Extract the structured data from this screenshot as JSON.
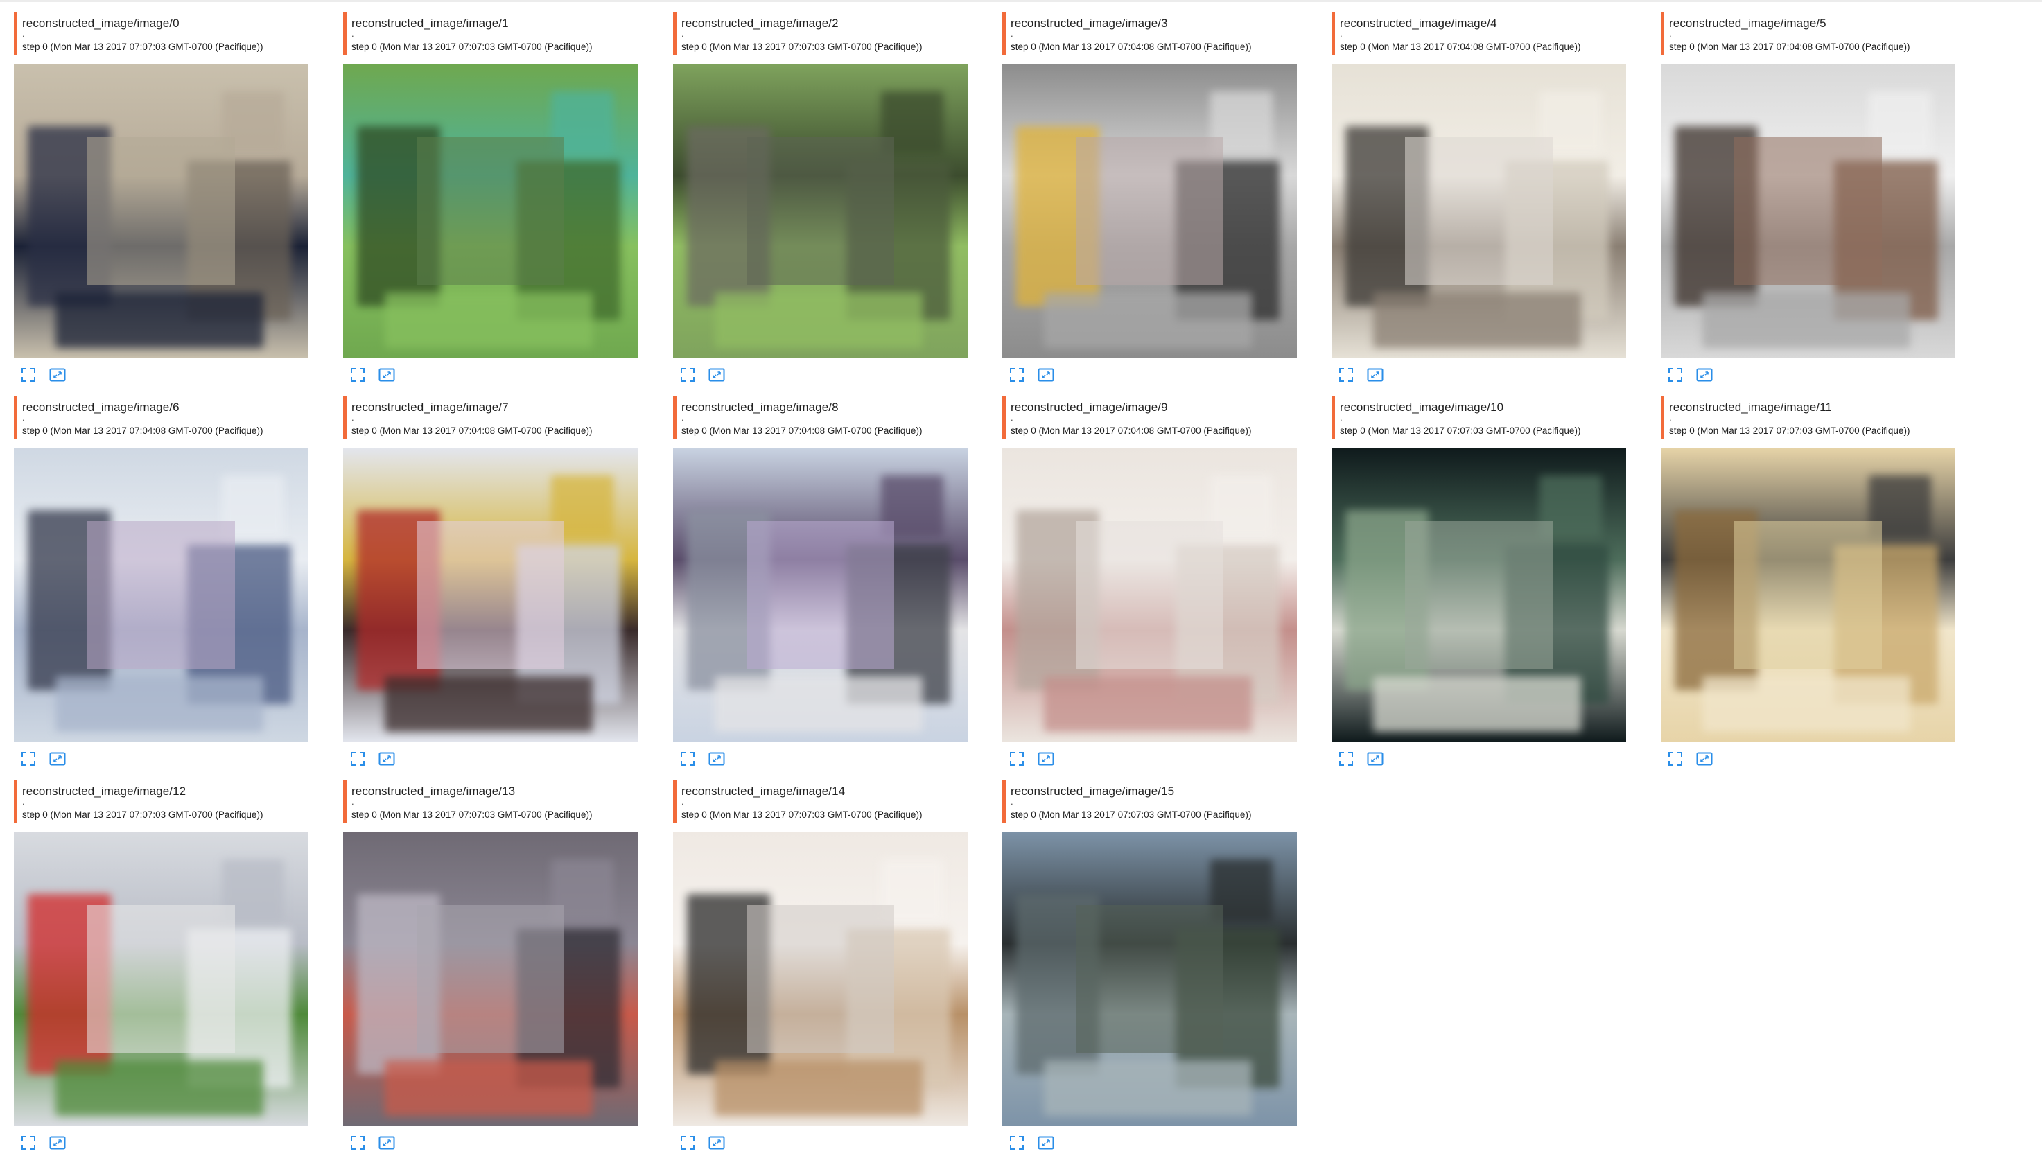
{
  "accent_color": "#f26b3a",
  "icon_color": "#2a8ee8",
  "step_text": "step 0",
  "cards": [
    {
      "title": "reconstructed_image/image/0",
      "dot": ".",
      "step": "step 0 (Mon Mar 13 2017 07:07:03 GMT-0700 (Pacifique))",
      "palette": [
        "#c9c0ad",
        "#6b6257",
        "#2a2f45",
        "#1b2236",
        "#b7ab99"
      ],
      "mask": "#b2a996"
    },
    {
      "title": "reconstructed_image/image/1",
      "dot": ".",
      "step": "step 0 (Mon Mar 13 2017 07:07:03 GMT-0700 (Pacifique))",
      "palette": [
        "#6fa84f",
        "#3f6a2c",
        "#2e4a22",
        "#87c05e",
        "#4fb39a"
      ],
      "mask": "#5b7d4a"
    },
    {
      "title": "reconstructed_image/image/2",
      "dot": ".",
      "step": "step 0 (Mon Mar 13 2017 07:07:03 GMT-0700 (Pacifique))",
      "palette": [
        "#7fa35d",
        "#4b5a3c",
        "#6b6a60",
        "#91bd62",
        "#3c4c2e"
      ],
      "mask": "#5d6453"
    },
    {
      "title": "reconstructed_image/image/3",
      "dot": ".",
      "step": "step 0 (Mon Mar 13 2017 07:04:08 GMT-0700 (Pacifique))",
      "palette": [
        "#8c8c8c",
        "#2d2d2d",
        "#e0b33a",
        "#a7a7a7",
        "#d8d8d8"
      ],
      "mask": "#b8a7a8"
    },
    {
      "title": "reconstructed_image/image/4",
      "dot": ".",
      "step": "step 0 (Mon Mar 13 2017 07:04:08 GMT-0700 (Pacifique))",
      "palette": [
        "#e6e1d6",
        "#d2cbbd",
        "#3d3a36",
        "#8a7f73",
        "#f2eee6"
      ],
      "mask": "#dcd7d2"
    },
    {
      "title": "reconstructed_image/image/5",
      "dot": ".",
      "step": "step 0 (Mon Mar 13 2017 07:04:08 GMT-0700 (Pacifique))",
      "palette": [
        "#d9d9d9",
        "#7d5a46",
        "#3b302a",
        "#a8a8a8",
        "#efefef"
      ],
      "mask": "#8f6d5c"
    },
    {
      "title": "reconstructed_image/image/6",
      "dot": ".",
      "step": "step 0 (Mon Mar 13 2017 07:04:08 GMT-0700 (Pacifique))",
      "palette": [
        "#cfd8e3",
        "#4a5a82",
        "#34394c",
        "#a7b4cb",
        "#e9edf2"
      ],
      "mask": "#b9a8c6"
    },
    {
      "title": "reconstructed_image/image/7",
      "dot": ".",
      "step": "step 0 (Mon Mar 13 2017 07:04:08 GMT-0700 (Pacifique))",
      "palette": [
        "#e3e6ee",
        "#d0d4e2",
        "#b02a2a",
        "#3a2b2b",
        "#d6b640"
      ],
      "mask": "#e3cfe0"
    },
    {
      "title": "reconstructed_image/image/8",
      "dot": ".",
      "step": "step 0 (Mon Mar 13 2017 07:04:08 GMT-0700 (Pacifique))",
      "palette": [
        "#c9d3e2",
        "#3e4149",
        "#8b91a0",
        "#e4e4e6",
        "#5a4d6b"
      ],
      "mask": "#b9a9d2"
    },
    {
      "title": "reconstructed_image/image/9",
      "dot": ".",
      "step": "step 0 (Mon Mar 13 2017 07:04:08 GMT-0700 (Pacifique))",
      "palette": [
        "#ebe5df",
        "#d6ccc4",
        "#b4a79e",
        "#c48f8b",
        "#f3efeb"
      ],
      "mask": "#e6e0dc"
    },
    {
      "title": "reconstructed_image/image/10",
      "dot": ".",
      "step": "step 0 (Mon Mar 13 2017 07:07:03 GMT-0700 (Pacifique))",
      "palette": [
        "#0f1a1c",
        "#2f4a40",
        "#8aa58a",
        "#d7d9d0",
        "#4d6d5b"
      ],
      "mask": "#9aa89a"
    },
    {
      "title": "reconstructed_image/image/11",
      "dot": ".",
      "step": "step 0 (Mon Mar 13 2017 07:07:03 GMT-0700 (Pacifique))",
      "palette": [
        "#e7d4a8",
        "#c9a86b",
        "#8b6a3c",
        "#f1e6cb",
        "#3d3d3d"
      ],
      "mask": "#e0cf9f"
    },
    {
      "title": "reconstructed_image/image/12",
      "dot": ".",
      "step": "step 0 (Mon Mar 13 2017 07:07:03 GMT-0700 (Pacifique))",
      "palette": [
        "#d8dbe0",
        "#eef0f3",
        "#d32a2a",
        "#4f8a3a",
        "#b8bcc6"
      ],
      "mask": "#e9e9ea"
    },
    {
      "title": "reconstructed_image/image/13",
      "dot": ".",
      "step": "step 0 (Mon Mar 13 2017 07:07:03 GMT-0700 (Pacifique))",
      "palette": [
        "#6f6a74",
        "#2f2c34",
        "#bdb8c4",
        "#c85a4a",
        "#8b8693"
      ],
      "mask": "#a9a6ae"
    },
    {
      "title": "reconstructed_image/image/14",
      "dot": ".",
      "step": "step 0 (Mon Mar 13 2017 07:07:03 GMT-0700 (Pacifique))",
      "palette": [
        "#efe9e3",
        "#d9c8b3",
        "#2b2b2b",
        "#b89067",
        "#f6f2ee"
      ],
      "mask": "#cfcac6"
    },
    {
      "title": "reconstructed_image/image/15",
      "dot": ".",
      "step": "step 0 (Mon Mar 13 2017 07:07:03 GMT-0700 (Pacifique))",
      "palette": [
        "#7d93a8",
        "#3b4a3c",
        "#5d6a6d",
        "#a8b5b9",
        "#2a2f30"
      ],
      "mask": "#566357"
    }
  ]
}
